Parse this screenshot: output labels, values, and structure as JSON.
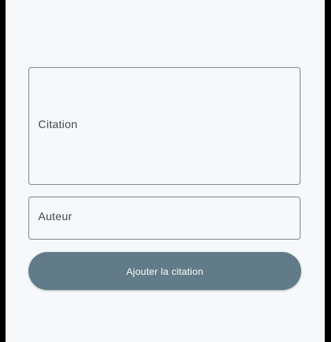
{
  "form": {
    "quote_field": {
      "placeholder": "Citation",
      "value": ""
    },
    "author_field": {
      "placeholder": "Auteur",
      "value": ""
    },
    "submit_label": "Ajouter la citation"
  },
  "colors": {
    "background": "#f5f9fc",
    "outline": "#73777f",
    "button": "#627b88",
    "button_text": "#ffffff",
    "placeholder_text": "#42474e"
  }
}
